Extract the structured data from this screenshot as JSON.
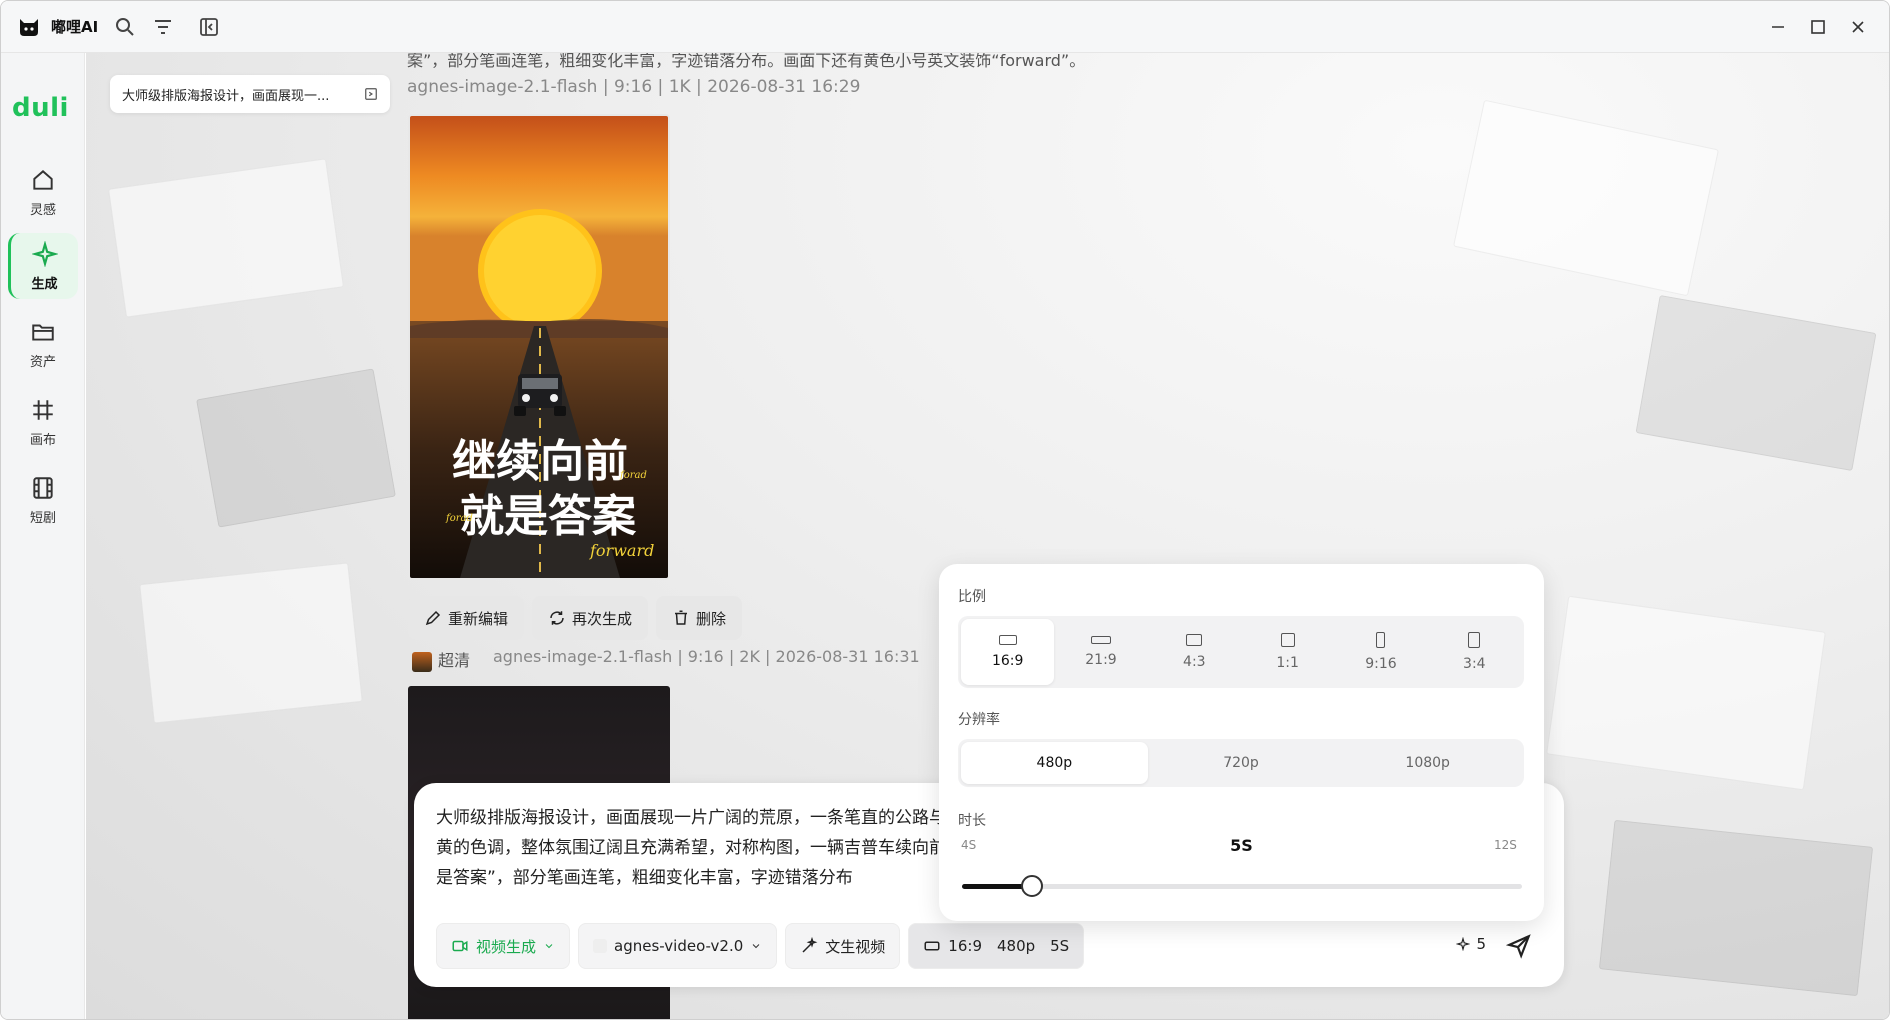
{
  "app": {
    "name": "嘟哩AI",
    "brand": "duli"
  },
  "sidebar": {
    "items": [
      {
        "label": "灵感",
        "icon": "home-icon"
      },
      {
        "label": "生成",
        "icon": "sparkle-icon"
      },
      {
        "label": "资产",
        "icon": "folder-icon"
      },
      {
        "label": "画布",
        "icon": "crop-icon"
      },
      {
        "label": "短剧",
        "icon": "film-icon"
      }
    ]
  },
  "main": {
    "prompt_chip": "大师级排版海报设计，画面展现一...",
    "top_clip": "案”，部分笔画连笔，粗细变化丰富，字迹错落分布。画面下还有黄色小号英文装饰“forward”。",
    "result1_meta": "agnes-image-2.1-flash  |  9:16  |  1K  |  2026-08-31 16:29",
    "poster_lines": [
      "继续向前",
      "就是答案"
    ],
    "poster_small": [
      "forad",
      "forad",
      "forward"
    ],
    "actions": {
      "reedit": "重新编辑",
      "regenerate": "再次生成",
      "delete": "删除"
    },
    "result2_hd": "超清",
    "result2_meta": "agnes-image-2.1-flash | 9:16 | 2K | 2026-08-31 16:31"
  },
  "composer": {
    "text": "大师级排版海报设计，画面展现一片广阔的荒原，一条笔直的公路与金黄的色调，整体氛围辽阔且充满希望，对称构图，一辆吉普车续向前 就是答案”，部分笔画连笔，粗细变化丰富，字迹错落分布",
    "mode": "视频生成",
    "model": "agnes-video-v2.0",
    "type": "文生视频",
    "summary_ratio": "16:9",
    "summary_res": "480p",
    "summary_dur": "5S",
    "credits": "5"
  },
  "settings": {
    "ratio_label": "比例",
    "ratios": [
      "16:9",
      "21:9",
      "4:3",
      "1:1",
      "9:16",
      "3:4"
    ],
    "ratio_selected": "16:9",
    "resolution_label": "分辨率",
    "resolutions": [
      "480p",
      "720p",
      "1080p"
    ],
    "resolution_selected": "480p",
    "duration_label": "时长",
    "duration_min": "4S",
    "duration_value": "5S",
    "duration_max": "12S",
    "duration_fraction": 0.125
  },
  "colors": {
    "accent": "#20c15a",
    "active_bg": "#e7f7ec"
  }
}
